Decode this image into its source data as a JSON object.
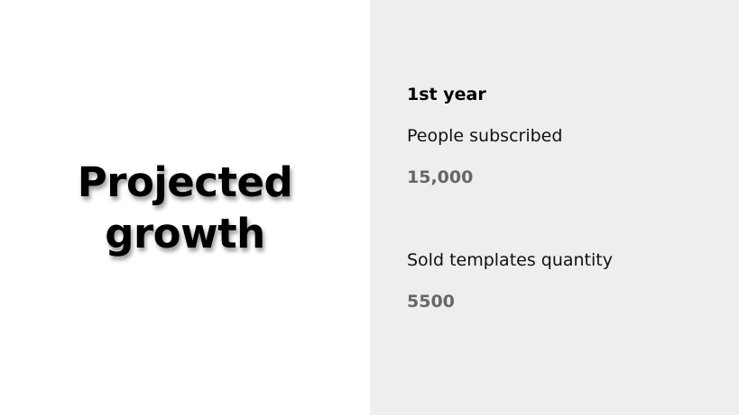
{
  "slide": {
    "title_line1": "Projected",
    "title_line2": "growth",
    "period": "1st year",
    "metrics": [
      {
        "label": "People subscribed",
        "value": "15,000"
      },
      {
        "label": "Sold templates quantity",
        "value": "5500"
      }
    ]
  },
  "colors": {
    "right_panel_background": "#eeeeee",
    "left_panel_background": "#ffffff",
    "title_text": "#000000",
    "value_text": "#666666"
  }
}
